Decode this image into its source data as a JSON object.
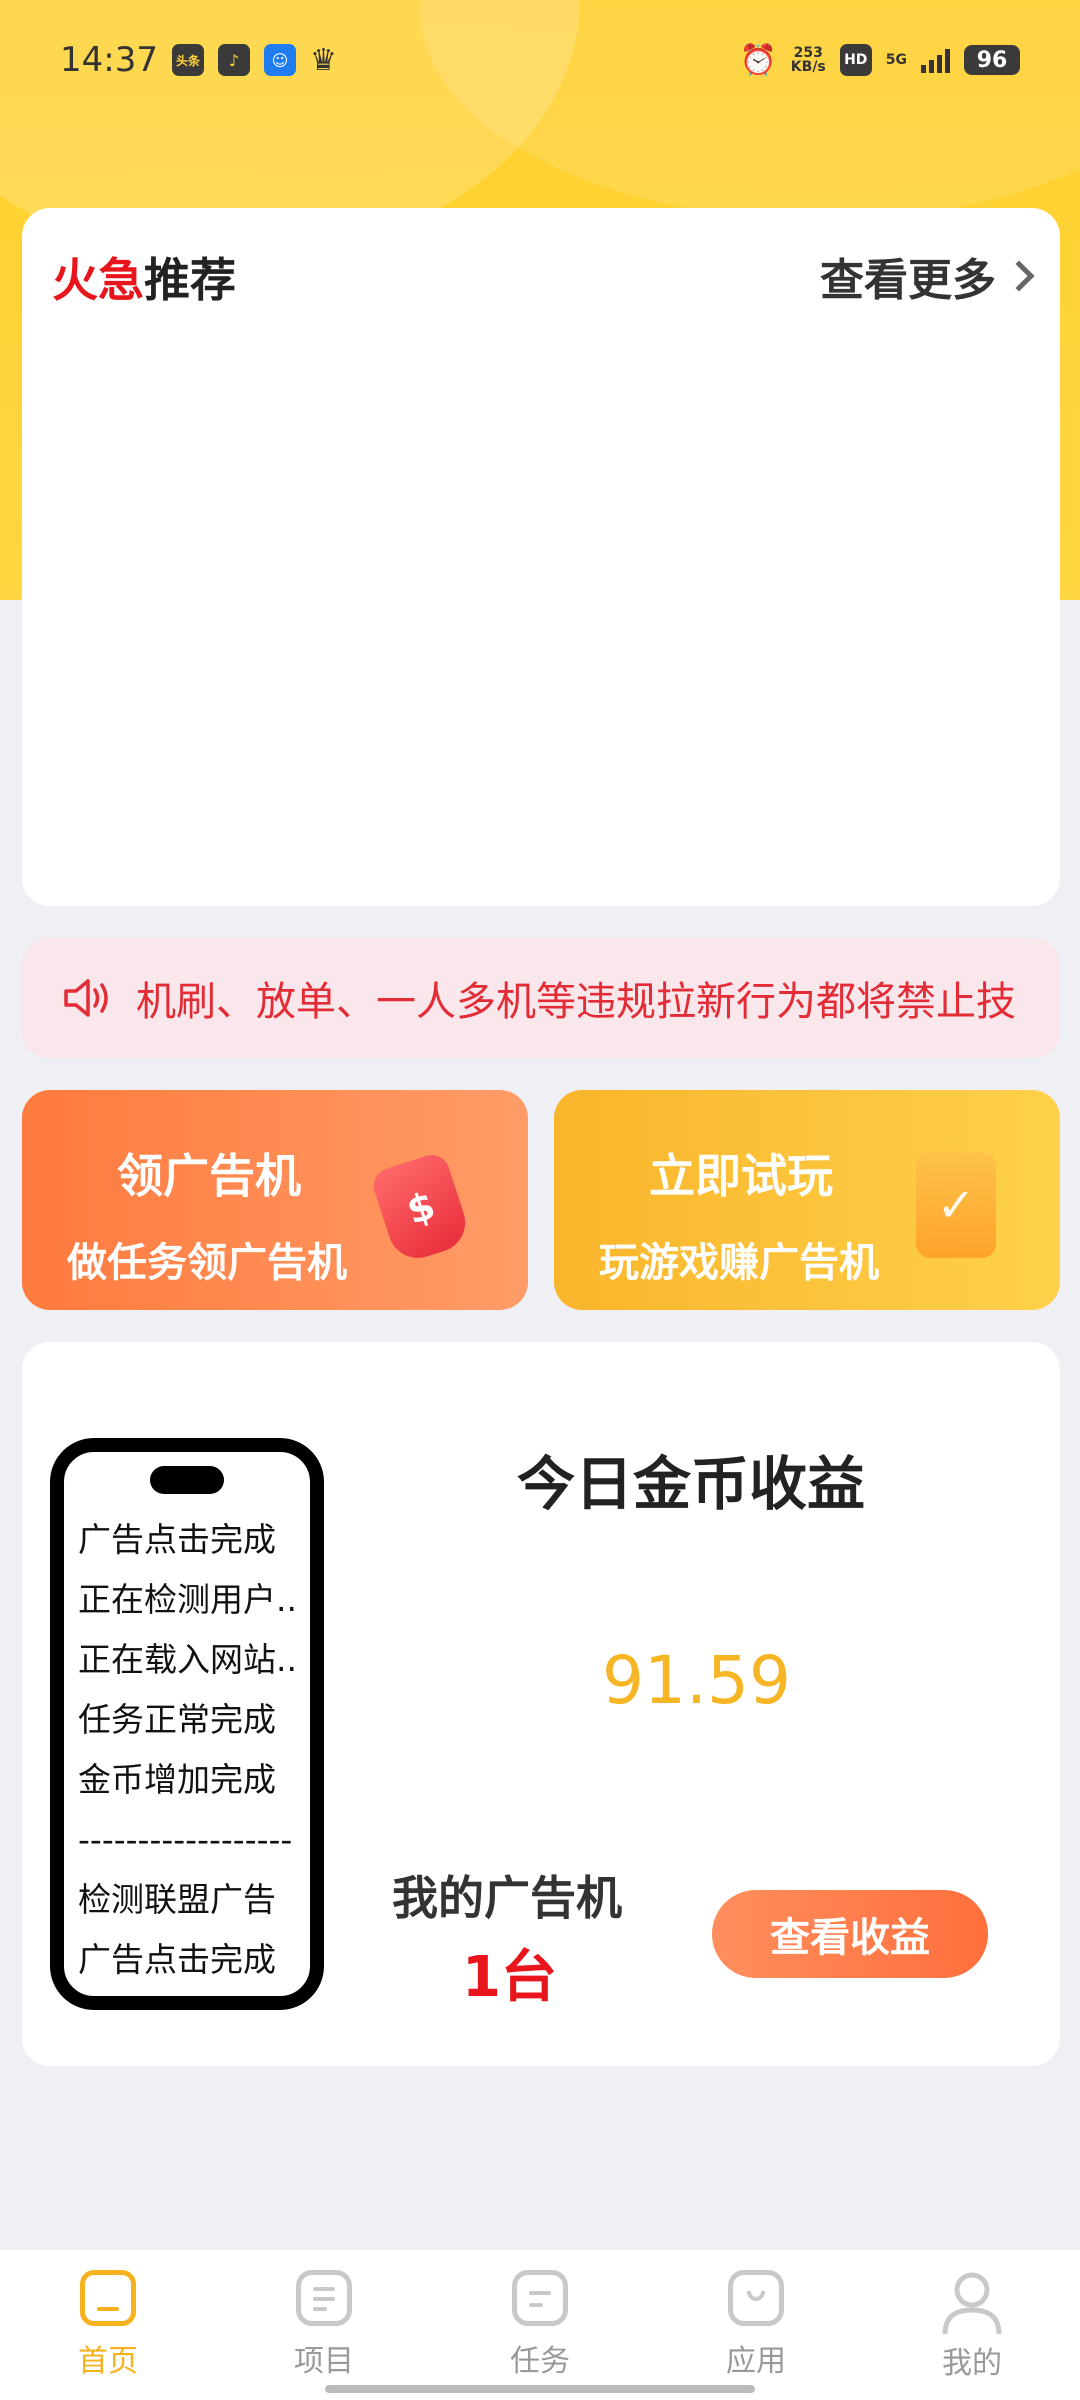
{
  "status_bar": {
    "time": "14:37",
    "app_icons": [
      "头条",
      "抖",
      "机",
      "冠"
    ],
    "net_speed_value": "253",
    "net_speed_unit": "KB/s",
    "hd": "HD",
    "network": "5G",
    "battery": "96"
  },
  "hot": {
    "title_red": "火急",
    "title_rest": "推荐",
    "see_more": "查看更多"
  },
  "notice": {
    "text": "机刷、放单、一人多机等违规拉新行为都将禁止技"
  },
  "actions": [
    {
      "title": "领广告机",
      "subtitle": "做任务领广告机",
      "icon": "$"
    },
    {
      "title": "立即试玩",
      "subtitle": "玩游戏赚广告机",
      "icon": "✓"
    }
  ],
  "earnings": {
    "phone_log": [
      "广告点击完成",
      "正在检测用户..",
      "正在载入网站..",
      "任务正常完成",
      "金币增加完成",
      "------------------",
      "检测联盟广告",
      "广告点击完成"
    ],
    "title": "今日金币收益",
    "value": "91.59",
    "my_machine_label": "我的广告机",
    "my_machine_count": "1台",
    "view_button": "查看收益"
  },
  "nav": [
    {
      "label": "首页",
      "icon": "home-icon",
      "active": true
    },
    {
      "label": "项目",
      "icon": "project-icon",
      "active": false
    },
    {
      "label": "任务",
      "icon": "task-icon",
      "active": false
    },
    {
      "label": "应用",
      "icon": "app-icon",
      "active": false
    },
    {
      "label": "我的",
      "icon": "profile-icon",
      "active": false
    }
  ],
  "colors": {
    "brand_yellow": "#ffd43a",
    "hot_red": "#e8161c",
    "earn_value": "#f5b525",
    "nav_active": "#f5b21d"
  }
}
